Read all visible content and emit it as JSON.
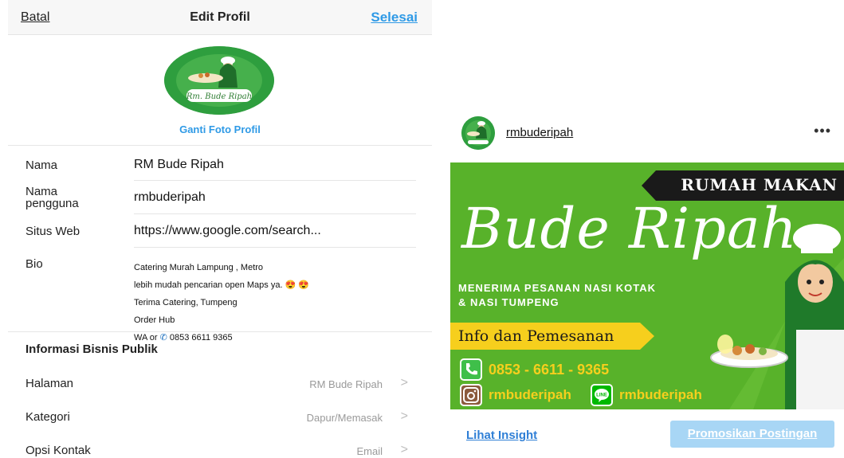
{
  "edit_profile": {
    "nav": {
      "cancel": "Batal",
      "title": "Edit Profil",
      "done": "Selesai"
    },
    "change_photo": "Ganti Foto Profil",
    "avatar_logo_text": "Rm. Bude Ripah",
    "fields": {
      "name": {
        "label": "Nama",
        "value": "RM Bude Ripah"
      },
      "username": {
        "label": "Nama pengguna",
        "label_line1": "Nama",
        "label_line2": "pengguna",
        "value": "rmbuderipah"
      },
      "website": {
        "label": "Situs Web",
        "value": "https://www.google.com/search..."
      },
      "bio": {
        "label": "Bio",
        "line1": "Catering Murah Lampung , Metro",
        "line2": "lebih mudah pencarian open Maps ya.",
        "line2_emoji": "😍 😍",
        "line3": "Terima Catering, Tumpeng",
        "line4": "Order Hub",
        "line5_prefix": "WA or",
        "line5_phone": "0853 6611 9365"
      }
    },
    "business": {
      "title": "Informasi Bisnis Publik",
      "rows": [
        {
          "label": "Halaman",
          "value": "RM Bude Ripah"
        },
        {
          "label": "Kategori",
          "value": "Dapur/Memasak"
        },
        {
          "label": "Opsi Kontak",
          "value": "Email"
        }
      ],
      "chevron": ">"
    }
  },
  "post": {
    "username": "rmbuderipah",
    "more": "•••",
    "banner": {
      "tag": "RUMAH MAKAN",
      "name": "Bude Ripah",
      "line1": "MENERIMA PESANAN NASI KOTAK",
      "line2": "& NASI TUMPENG",
      "info": "Info dan Pemesanan",
      "phone": "0853 - 6611 - 9365",
      "instagram": "rmbuderipah",
      "line_app": "rmbuderipah"
    },
    "insight_link": "Lihat Insight",
    "promote_button": "Promosikan Postingan"
  },
  "colors": {
    "accent_blue": "#2f9ae6",
    "banner_green": "#58b22a",
    "banner_yellow": "#f6cf1d",
    "promo_button": "#a8d6f5"
  },
  "icons": [
    "chevron-right-icon",
    "phone-icon",
    "instagram-icon",
    "line-app-icon",
    "more-icon"
  ]
}
